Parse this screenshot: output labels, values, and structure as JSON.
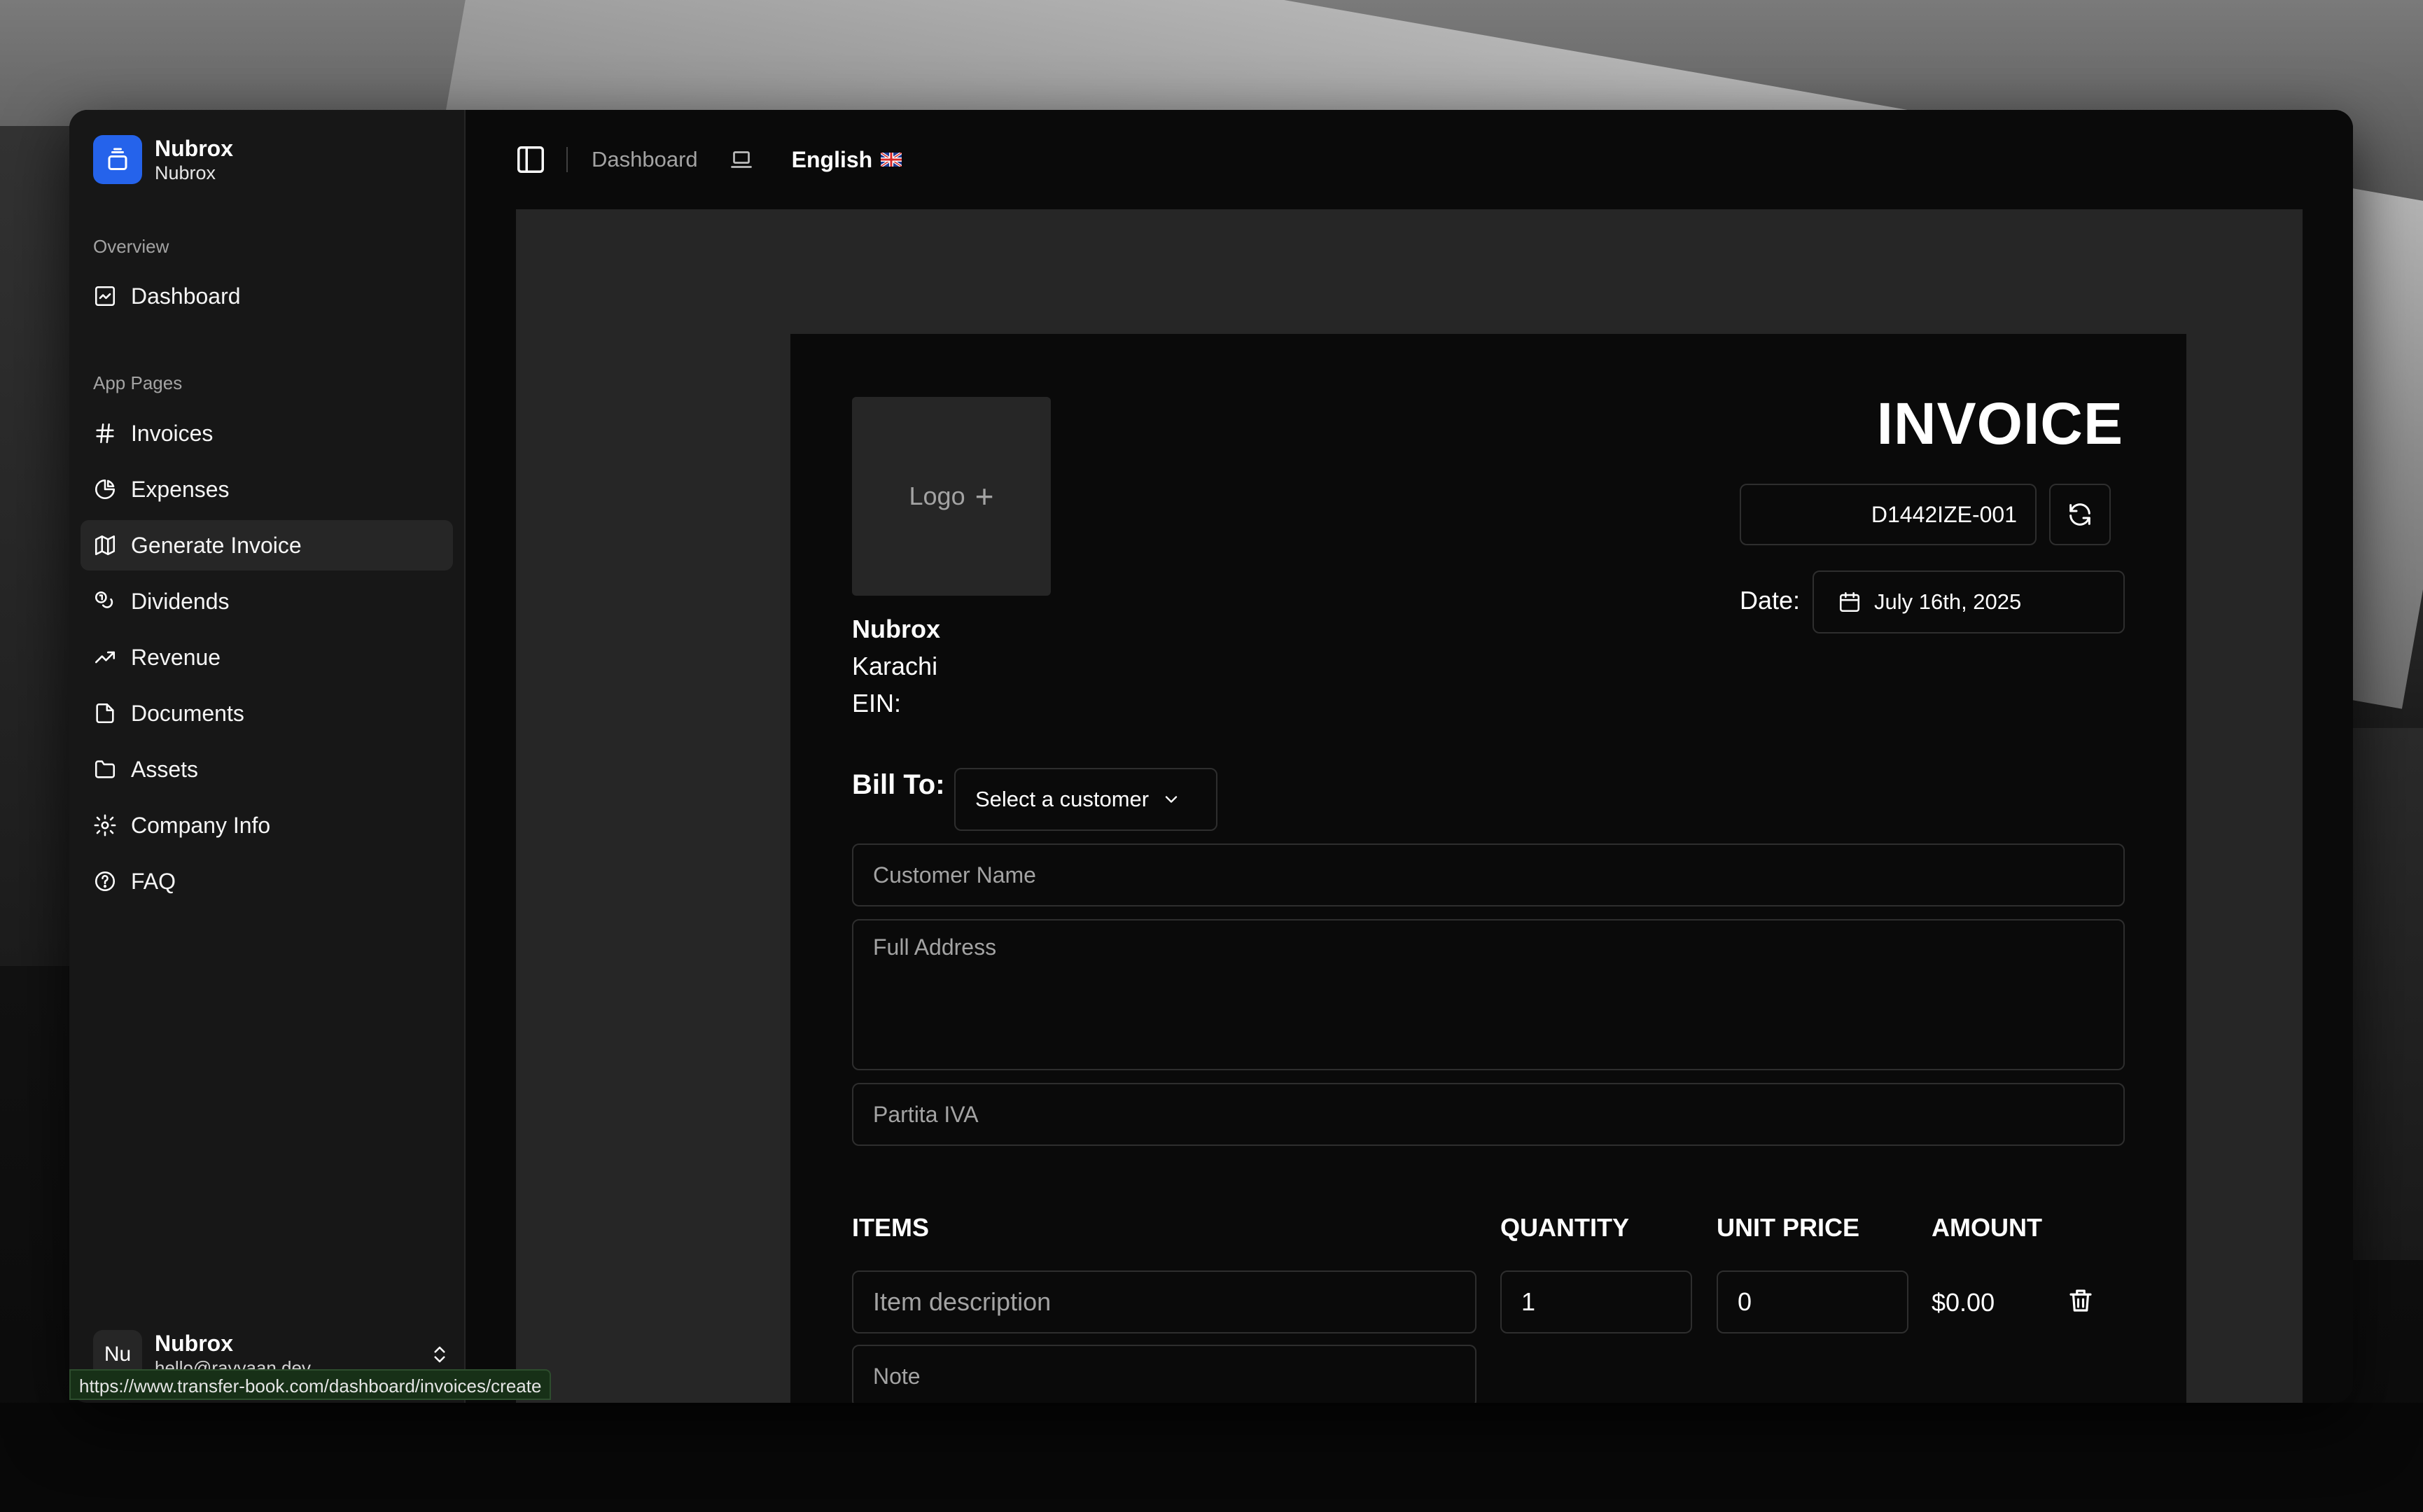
{
  "brand": {
    "name": "Nubrox",
    "subtitle": "Nubrox"
  },
  "sidebar": {
    "overview_label": "Overview",
    "overview_items": [
      {
        "label": "Dashboard",
        "icon": "dashboard-icon"
      }
    ],
    "app_pages_label": "App Pages",
    "items": [
      {
        "label": "Invoices",
        "icon": "hash-icon"
      },
      {
        "label": "Expenses",
        "icon": "pie-chart-icon"
      },
      {
        "label": "Generate Invoice",
        "icon": "map-icon",
        "active": true
      },
      {
        "label": "Dividends",
        "icon": "coins-icon"
      },
      {
        "label": "Revenue",
        "icon": "trending-up-icon"
      },
      {
        "label": "Documents",
        "icon": "file-icon"
      },
      {
        "label": "Assets",
        "icon": "folder-icon"
      },
      {
        "label": "Company Info",
        "icon": "gear-icon"
      },
      {
        "label": "FAQ",
        "icon": "help-circle-icon"
      }
    ],
    "user": {
      "initials": "Nu",
      "name": "Nubrox",
      "email": "hello@rayyaan.dev"
    }
  },
  "topbar": {
    "breadcrumb": "Dashboard",
    "language": "English"
  },
  "invoice": {
    "title": "INVOICE",
    "logo_label": "Logo",
    "logo_plus": "+",
    "number": "D1442IZE-001",
    "date_label": "Date:",
    "date_value": "July 16th, 2025",
    "company_name": "Nubrox",
    "company_city": "Karachi",
    "company_ein": "EIN:",
    "bill_to_label": "Bill To:",
    "customer_select": "Select a customer",
    "customer_name_placeholder": "Customer Name",
    "address_placeholder": "Full Address",
    "vat_placeholder": "Partita IVA",
    "columns": {
      "items": "ITEMS",
      "quantity": "QUANTITY",
      "unit_price": "UNIT PRICE",
      "amount": "AMOUNT"
    },
    "line_items": [
      {
        "description_placeholder": "Item description",
        "quantity": "1",
        "unit_price": "0",
        "amount": "$0.00",
        "note_placeholder": "Note"
      }
    ]
  },
  "status_bar": {
    "url": "https://www.transfer-book.com/dashboard/invoices/create"
  },
  "colors": {
    "accent": "#2563eb",
    "panel": "#171717",
    "canvas": "#262626",
    "paper": "#0a0a0a"
  }
}
